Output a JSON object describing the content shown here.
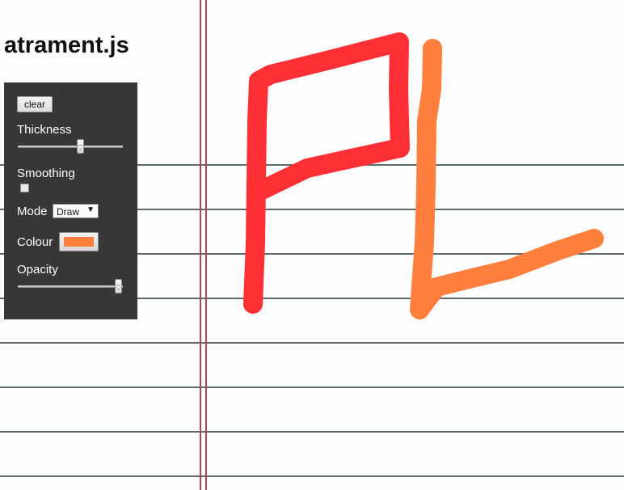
{
  "title": "atrament.js",
  "controls": {
    "clear_label": "clear",
    "thickness_label": "Thickness",
    "thickness_value": 0.6,
    "smoothing_label": "Smoothing",
    "smoothing_checked": false,
    "mode_label": "Mode",
    "mode_selected": "Draw",
    "colour_label": "Colour",
    "colour_value": "#ff7f3f",
    "opacity_label": "Opacity",
    "opacity_value": 1.0
  },
  "drawing": {
    "stroke_colors": [
      "#ff3035",
      "#ff7f3f"
    ]
  },
  "colors": {
    "panel_bg": "#373737",
    "rule_line": "#5f6b6b",
    "margin_line": "#a8484f"
  }
}
